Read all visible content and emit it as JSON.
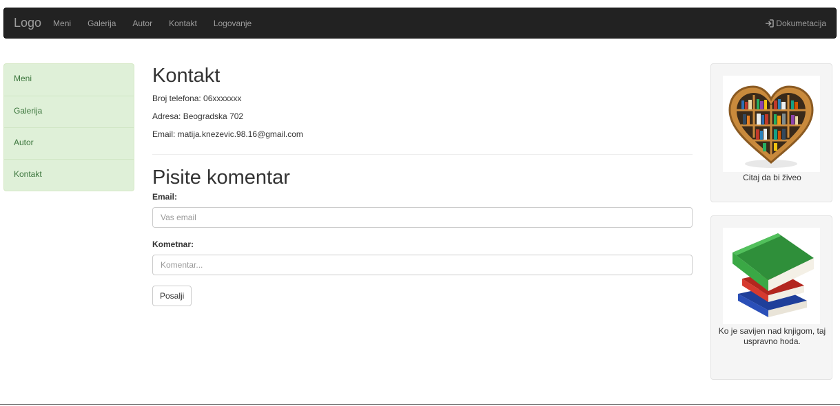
{
  "navbar": {
    "brand": "Logo",
    "items": [
      {
        "label": "Meni"
      },
      {
        "label": "Galerija"
      },
      {
        "label": "Autor"
      },
      {
        "label": "Kontakt"
      },
      {
        "label": "Logovanje"
      }
    ],
    "right_label": "Dokumetacija",
    "right_icon": "login-icon"
  },
  "sidebar": {
    "items": [
      {
        "label": "Meni"
      },
      {
        "label": "Galerija"
      },
      {
        "label": "Autor"
      },
      {
        "label": "Kontakt"
      }
    ]
  },
  "contact": {
    "title": "Kontakt",
    "phone": "Broj telefona: 06xxxxxxx",
    "address": "Adresa: Beogradska 702",
    "email": "Email: matija.knezevic.98.16@gmail.com"
  },
  "comment_form": {
    "title": "Pisite komentar",
    "email_label": "Email:",
    "email_placeholder": "Vas email",
    "comment_label": "Kometnar:",
    "comment_placeholder": "Komentar...",
    "submit_label": "Posalji"
  },
  "panels": [
    {
      "image": "heart-bookshelf-image",
      "caption": "Citaj da bi živeo"
    },
    {
      "image": "book-stack-image",
      "caption": "Ko je savijen nad knjigom, taj uspravno hoda."
    }
  ],
  "colors": {
    "navbar_bg": "#222222",
    "sidebar_bg": "#dff0d8",
    "sidebar_text": "#3c763d",
    "panel_bg": "#f5f5f5"
  }
}
